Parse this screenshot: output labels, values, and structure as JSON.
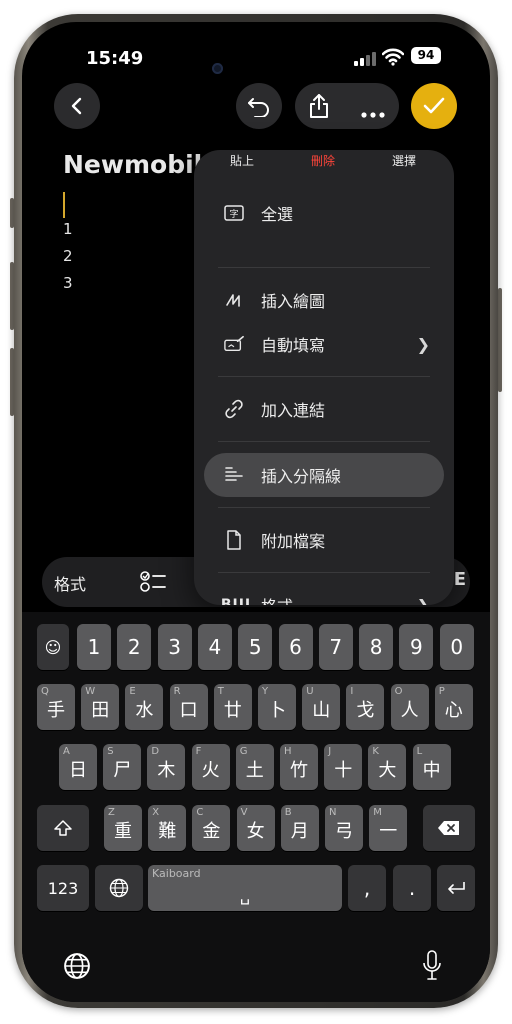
{
  "status": {
    "time": "15:49",
    "battery": "94"
  },
  "note": {
    "title": "Newmobil",
    "lines": [
      "1",
      "2",
      "3"
    ]
  },
  "menu": {
    "top": {
      "paste": "貼上",
      "delete": "刪除",
      "select": "選擇"
    },
    "items": [
      {
        "label": "全選",
        "icon": "select-all-icon"
      },
      {
        "label": "插入繪圖",
        "icon": "pencil-scribble-icon"
      },
      {
        "label": "自動填寫",
        "icon": "autofill-icon",
        "has_submenu": true
      },
      {
        "label": "加入連結",
        "icon": "link-icon"
      },
      {
        "label": "插入分隔線",
        "icon": "divider-lines-icon",
        "highlighted": true
      },
      {
        "label": "附加檔案",
        "icon": "document-icon"
      },
      {
        "label": "格式",
        "icon": "biu-format-icon",
        "prefix": "BIU",
        "has_submenu": true
      }
    ]
  },
  "toolbar": {
    "format_label": "格式",
    "right_glyph": "E"
  },
  "keyboard": {
    "number_row": [
      "1",
      "2",
      "3",
      "4",
      "5",
      "6",
      "7",
      "8",
      "9",
      "0"
    ],
    "row1": [
      {
        "main": "手",
        "sub": "Q"
      },
      {
        "main": "田",
        "sub": "W"
      },
      {
        "main": "水",
        "sub": "E"
      },
      {
        "main": "口",
        "sub": "R"
      },
      {
        "main": "廿",
        "sub": "T"
      },
      {
        "main": "卜",
        "sub": "Y"
      },
      {
        "main": "山",
        "sub": "U"
      },
      {
        "main": "戈",
        "sub": "I"
      },
      {
        "main": "人",
        "sub": "O"
      },
      {
        "main": "心",
        "sub": "P"
      }
    ],
    "row2": [
      {
        "main": "日",
        "sub": "A"
      },
      {
        "main": "尸",
        "sub": "S"
      },
      {
        "main": "木",
        "sub": "D"
      },
      {
        "main": "火",
        "sub": "F"
      },
      {
        "main": "土",
        "sub": "G"
      },
      {
        "main": "竹",
        "sub": "H"
      },
      {
        "main": "十",
        "sub": "J"
      },
      {
        "main": "大",
        "sub": "K"
      },
      {
        "main": "中",
        "sub": "L"
      }
    ],
    "row3": [
      {
        "main": "重",
        "sub": "Z"
      },
      {
        "main": "難",
        "sub": "X"
      },
      {
        "main": "金",
        "sub": "C"
      },
      {
        "main": "女",
        "sub": "V"
      },
      {
        "main": "月",
        "sub": "B"
      },
      {
        "main": "弓",
        "sub": "N"
      },
      {
        "main": "一",
        "sub": "M"
      }
    ],
    "numbers_key": "123",
    "space_hint": "Kaiboard",
    "space_glyph": "␣",
    "comma": ",",
    "period": "."
  }
}
